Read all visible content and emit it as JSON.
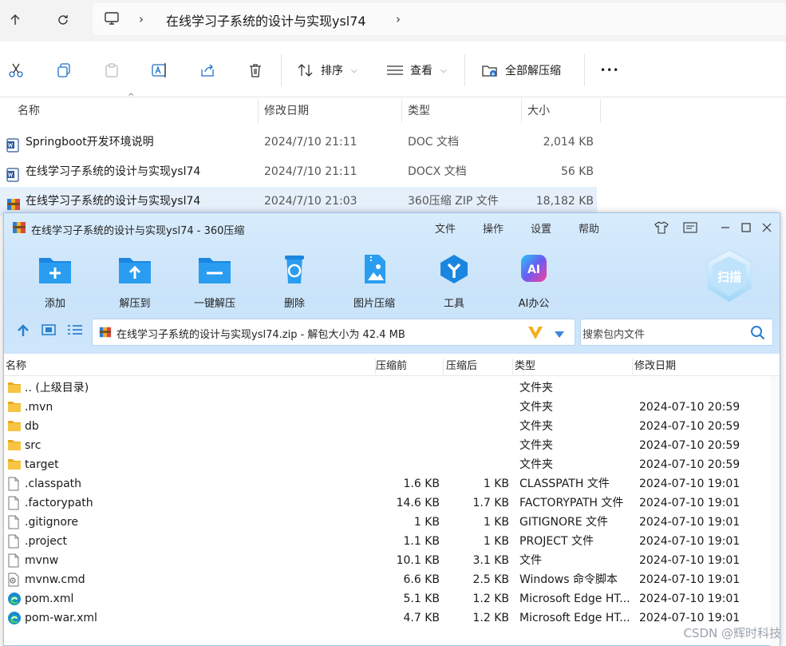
{
  "explorer": {
    "breadcrumb": "在线学习子系统的设计与实现ysl74",
    "toolbar": {
      "sort_label": "排序",
      "view_label": "查看",
      "extract_all_label": "全部解压缩",
      "more_label": "•••"
    },
    "columns": [
      "名称",
      "修改日期",
      "类型",
      "大小"
    ],
    "files": [
      {
        "name": "Springboot开发环境说明",
        "date": "2024/7/10 21:11",
        "type": "DOC 文档",
        "size": "2,014 KB",
        "icon": "word-doc-icon"
      },
      {
        "name": "在线学习子系统的设计与实现ysl74",
        "date": "2024/7/10 21:11",
        "type": "DOCX 文档",
        "size": "56 KB",
        "icon": "word-doc-icon"
      },
      {
        "name": "在线学习子系统的设计与实现ysl74",
        "date": "2024/7/10 21:03",
        "type": "360压缩 ZIP 文件",
        "size": "18,182 KB",
        "icon": "zip-archive-icon"
      }
    ]
  },
  "zip": {
    "window_title": "在线学习子系统的设计与实现ysl74 - 360压缩",
    "menu": [
      "文件",
      "操作",
      "设置",
      "帮助"
    ],
    "tools": [
      "添加",
      "解压到",
      "一键解压",
      "删除",
      "图片压缩",
      "工具",
      "AI办公"
    ],
    "ai_badge": "AI",
    "scan_label": "扫描",
    "path": "在线学习子系统的设计与实现ysl74.zip - 解包大小为 42.4 MB",
    "search_placeholder": "搜索包内文件",
    "columns": [
      "名称",
      "压缩前",
      "压缩后",
      "类型",
      "修改日期"
    ],
    "rows": [
      {
        "name": ".. (上级目录)",
        "before": "",
        "after": "",
        "type": "文件夹",
        "date": "",
        "icon": "folder-icon"
      },
      {
        "name": ".mvn",
        "before": "",
        "after": "",
        "type": "文件夹",
        "date": "2024-07-10 20:59",
        "icon": "folder-icon"
      },
      {
        "name": "db",
        "before": "",
        "after": "",
        "type": "文件夹",
        "date": "2024-07-10 20:59",
        "icon": "folder-icon"
      },
      {
        "name": "src",
        "before": "",
        "after": "",
        "type": "文件夹",
        "date": "2024-07-10 20:59",
        "icon": "folder-icon"
      },
      {
        "name": "target",
        "before": "",
        "after": "",
        "type": "文件夹",
        "date": "2024-07-10 20:59",
        "icon": "folder-icon"
      },
      {
        "name": ".classpath",
        "before": "1.6 KB",
        "after": "1 KB",
        "type": "CLASSPATH 文件",
        "date": "2024-07-10 19:01",
        "icon": "file-icon"
      },
      {
        "name": ".factorypath",
        "before": "14.6 KB",
        "after": "1.7 KB",
        "type": "FACTORYPATH 文件",
        "date": "2024-07-10 19:01",
        "icon": "file-icon"
      },
      {
        "name": ".gitignore",
        "before": "1 KB",
        "after": "1 KB",
        "type": "GITIGNORE 文件",
        "date": "2024-07-10 19:01",
        "icon": "file-icon"
      },
      {
        "name": ".project",
        "before": "1.1 KB",
        "after": "1 KB",
        "type": "PROJECT 文件",
        "date": "2024-07-10 19:01",
        "icon": "file-icon"
      },
      {
        "name": "mvnw",
        "before": "10.1 KB",
        "after": "3.1 KB",
        "type": "文件",
        "date": "2024-07-10 19:01",
        "icon": "file-icon"
      },
      {
        "name": "mvnw.cmd",
        "before": "6.6 KB",
        "after": "2.5 KB",
        "type": "Windows 命令脚本",
        "date": "2024-07-10 19:01",
        "icon": "cmd-script-icon"
      },
      {
        "name": "pom.xml",
        "before": "5.1 KB",
        "after": "1.2 KB",
        "type": "Microsoft Edge HT...",
        "date": "2024-07-10 19:01",
        "icon": "edge-icon"
      },
      {
        "name": "pom-war.xml",
        "before": "4.7 KB",
        "after": "1.2 KB",
        "type": "Microsoft Edge HT...",
        "date": "2024-07-10 19:01",
        "icon": "edge-icon"
      }
    ]
  },
  "watermark": "CSDN @辉时科技"
}
